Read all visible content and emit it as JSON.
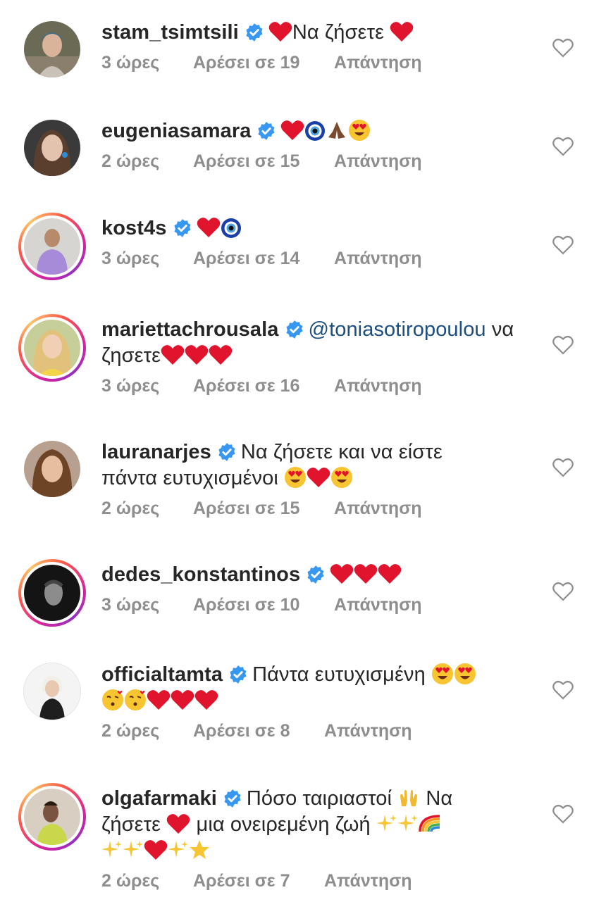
{
  "comments": [
    {
      "username": "stam_tsimtsili",
      "text": "Να ζήσετε",
      "time": "3 ώρες",
      "likes": "Αρέσει σε 19",
      "reply": "Απάντηση",
      "avatar_color": "#5a5a48"
    },
    {
      "username": "eugeniasamara",
      "text": "",
      "time": "2 ώρες",
      "likes": "Αρέσει σε 15",
      "reply": "Απάντηση",
      "avatar_color": "#6f5b50"
    },
    {
      "username": "kost4s",
      "text": "",
      "time": "3 ώρες",
      "likes": "Αρέσει σε 14",
      "reply": "Απάντηση",
      "avatar_color": "#a88bd8"
    },
    {
      "username": "mariettachrousala",
      "mention": "@toniasotiropoulou",
      "text_after_mention": "να",
      "text_line2": "ζησετε",
      "time": "3 ώρες",
      "likes": "Αρέσει σε 16",
      "reply": "Απάντηση",
      "avatar_color": "#d9b66a"
    },
    {
      "username": "lauranarjes",
      "text": "Να ζήσετε και να είστε",
      "text_line2": "πάντα ευτυχισμένοι",
      "time": "2 ώρες",
      "likes": "Αρέσει σε 15",
      "reply": "Απάντηση",
      "avatar_color": "#8a5a3c"
    },
    {
      "username": "dedes_konstantinos",
      "text": "",
      "time": "3 ώρες",
      "likes": "Αρέσει σε 10",
      "reply": "Απάντηση",
      "avatar_color": "#1e1e1e"
    },
    {
      "username": "officialtamta",
      "text": "Πάντα ευτυχισμένη",
      "time": "2 ώρες",
      "likes": "Αρέσει σε 8",
      "reply": "Απάντηση",
      "avatar_color": "#f2f2f2"
    },
    {
      "username": "olgafarmaki",
      "text": "Πόσο ταιριαστοί",
      "text_tail": "Να",
      "text_line2a": "ζήσετε",
      "text_line2b": "μια ονειρεμένη ζωή",
      "time": "2 ώρες",
      "likes": "Αρέσει σε 7",
      "reply": "Απάντηση",
      "avatar_color": "#c8d84a"
    }
  ],
  "colors": {
    "verified": "#3897f0",
    "heart": "#e0142c",
    "meta_text": "#8e8e8e",
    "mention": "#1c4e80"
  },
  "icons": {
    "like": "heart-outline-icon",
    "verified": "verified-badge-icon"
  }
}
